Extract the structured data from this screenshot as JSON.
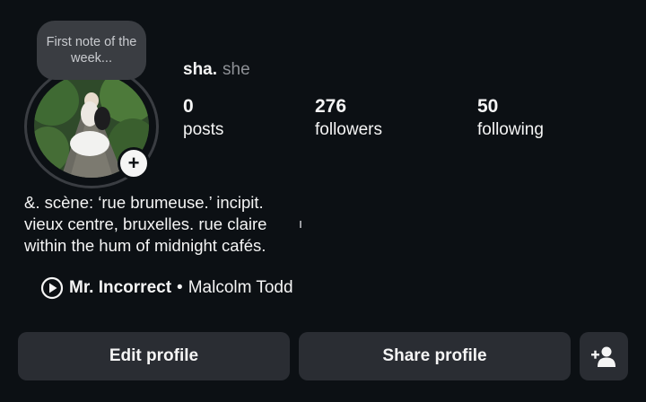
{
  "note": {
    "text": "First note of the week..."
  },
  "profile": {
    "username": "sha.",
    "pronouns": "she"
  },
  "stats": [
    {
      "value": "0",
      "label": "posts"
    },
    {
      "value": "276",
      "label": "followers"
    },
    {
      "value": "50",
      "label": "following"
    }
  ],
  "bio": [
    "&.   scène: ‘rue brumeuse.’ incipit.",
    "vieux centre, bruxelles. rue claire",
    "within the hum of midnight cafés."
  ],
  "music": {
    "icon": "play-circle-icon",
    "title": "Mr. Incorrect",
    "separator": "•",
    "artist": "Malcolm Todd"
  },
  "actions": {
    "edit_label": "Edit profile",
    "share_label": "Share profile",
    "discover_icon": "add-person-icon"
  },
  "colors": {
    "background": "#0c1014",
    "button": "#2a2d33",
    "note_bubble": "#3a3d42",
    "muted_text": "#8e9196"
  }
}
